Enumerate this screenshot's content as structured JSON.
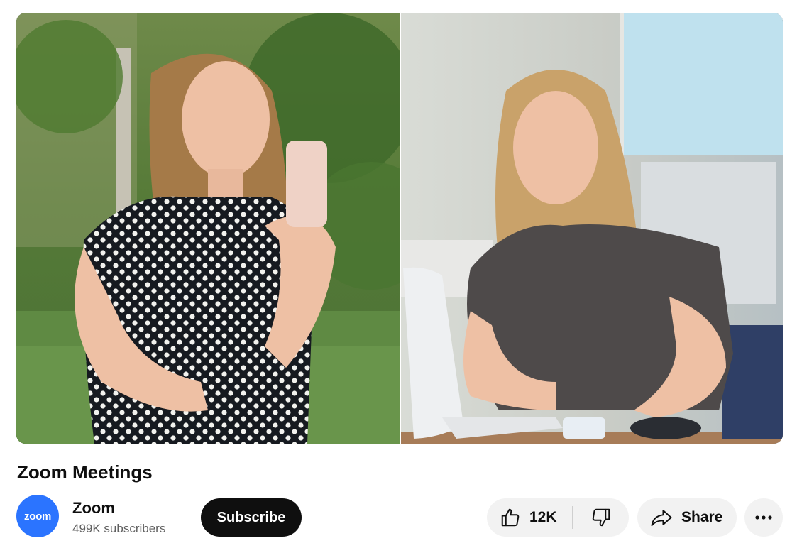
{
  "video": {
    "title": "Zoom Meetings"
  },
  "channel": {
    "avatar_text": "zoom",
    "name": "Zoom",
    "subscribers": "499K subscribers",
    "avatar_color": "#2b74ff"
  },
  "actions": {
    "subscribe_label": "Subscribe",
    "like_count": "12K",
    "share_label": "Share",
    "icons": [
      "thumbs-up-icon",
      "thumbs-down-icon",
      "share-arrow-icon",
      "more-horizontal-icon"
    ]
  }
}
